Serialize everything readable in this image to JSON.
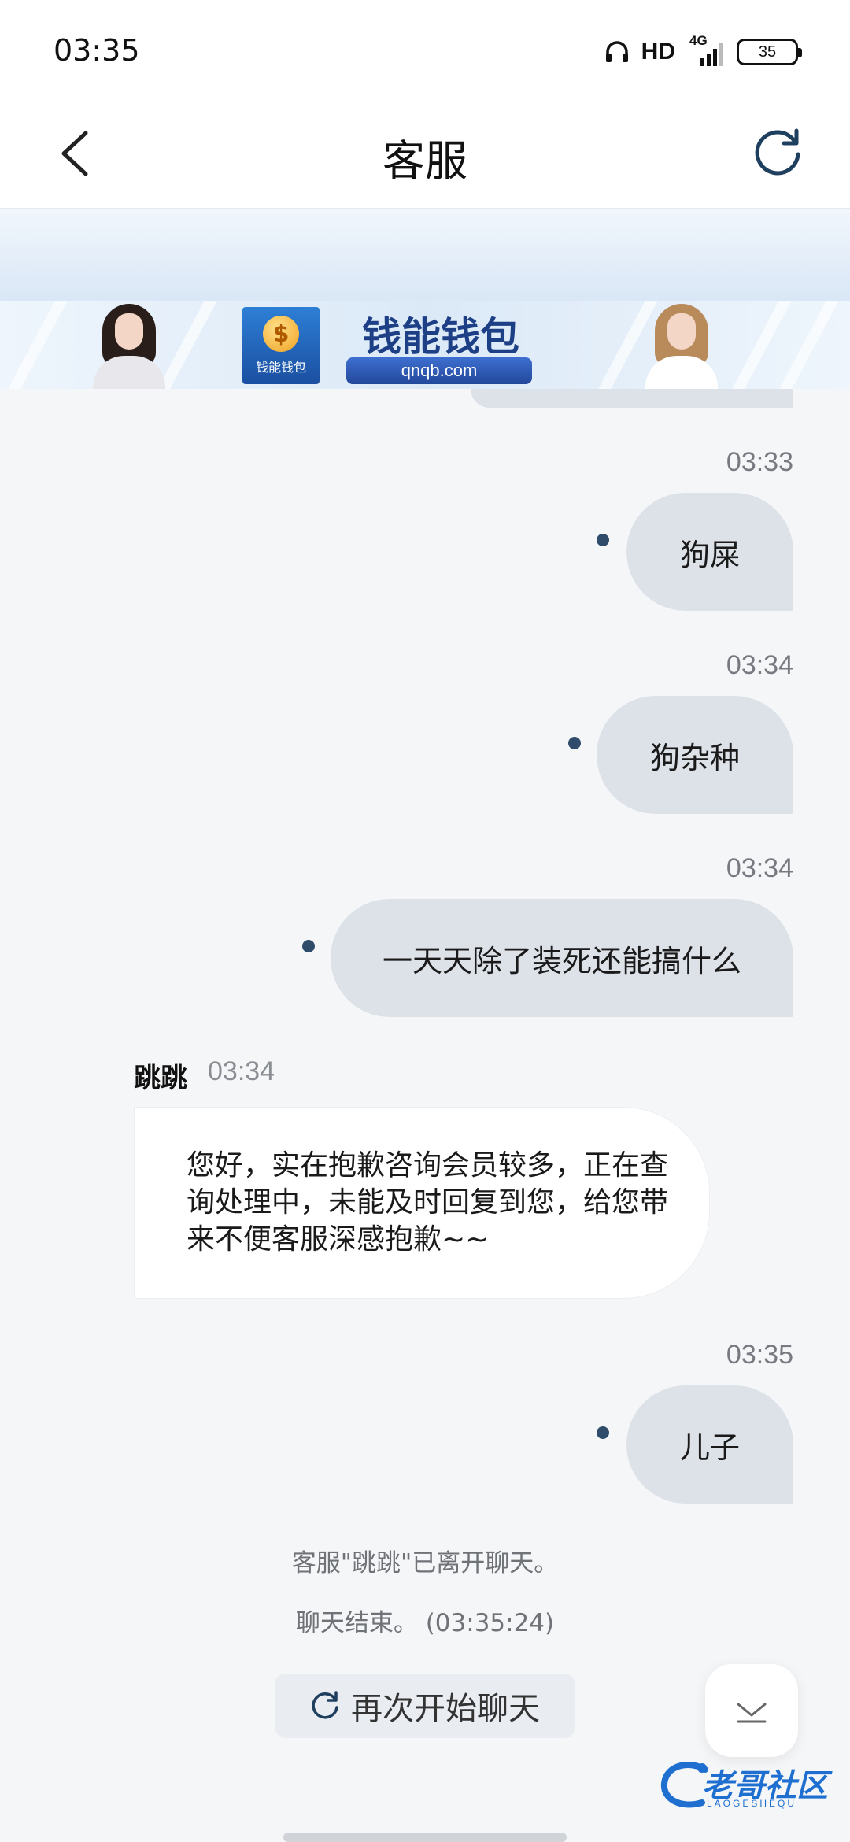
{
  "status_bar": {
    "time": "03:35",
    "hd_label": "HD",
    "network_label": "4G",
    "battery_level": "35"
  },
  "header": {
    "title": "客服"
  },
  "ad": {
    "title": "钱能钱包",
    "url": "qnqb.com",
    "logo_text": "钱能钱包",
    "logo_symbol": "$"
  },
  "chat": {
    "messages": [
      {
        "type": "outgoing",
        "time": "03:33",
        "text": "狗屎"
      },
      {
        "type": "outgoing",
        "time": "03:34",
        "text": "狗杂种"
      },
      {
        "type": "outgoing",
        "time": "03:34",
        "text": "一天天除了装死还能搞什么"
      },
      {
        "type": "incoming",
        "sender": "跳跳",
        "time": "03:34",
        "text": "您好，实在抱歉咨询会员较多，正在查询处理中，未能及时回复到您，给您带来不便客服深感抱歉~~"
      },
      {
        "type": "outgoing",
        "time": "03:35",
        "text": "儿子"
      }
    ],
    "system_messages": [
      "客服\"跳跳\"已离开聊天。",
      "聊天结束。 (03:35:24)"
    ],
    "restart_label": "再次开始聊天"
  },
  "watermark": {
    "text": "老哥社区",
    "subtext": "LAOGESHEQU"
  },
  "colors": {
    "outgoing_bubble": "#dde2e9",
    "incoming_bubble": "#ffffff",
    "background": "#f5f6f8",
    "read_dot": "#2f4d6a",
    "watermark": "#1e6fd0"
  }
}
